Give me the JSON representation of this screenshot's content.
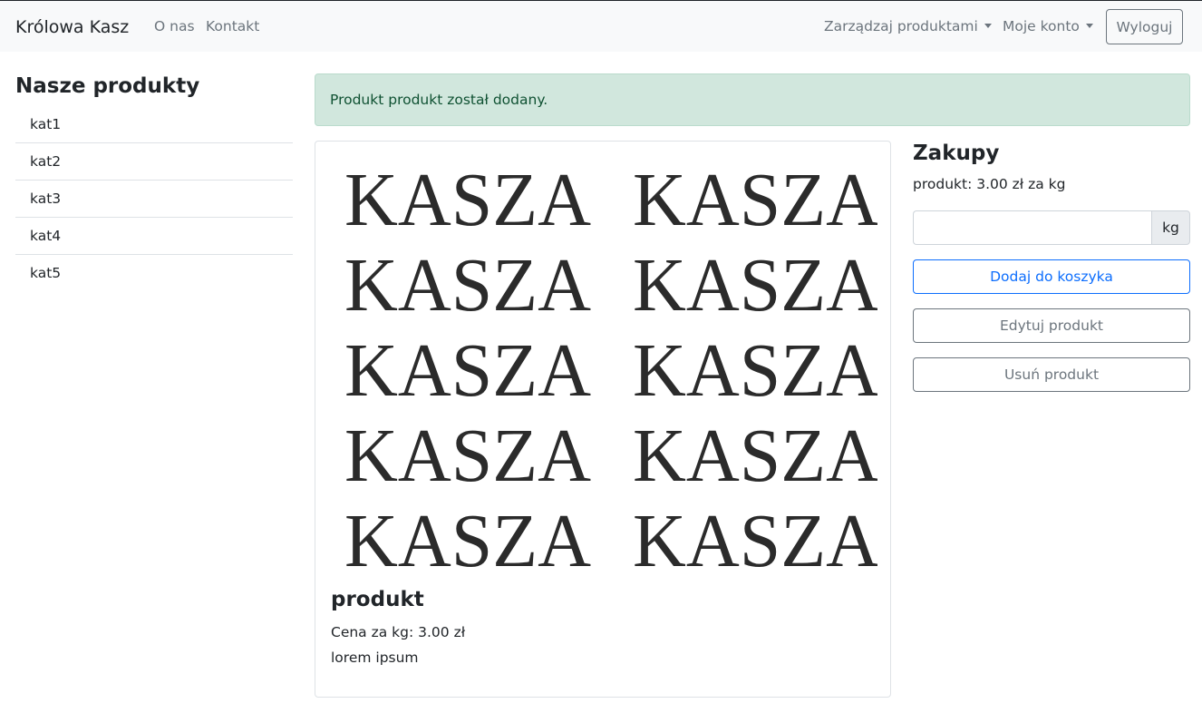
{
  "navbar": {
    "brand": "Królowa Kasz",
    "links": [
      "O nas",
      "Kontakt"
    ],
    "manage_products": "Zarządzaj produktami",
    "my_account": "Moje konto",
    "logout": "Wyloguj"
  },
  "sidebar": {
    "title": "Nasze produkty",
    "categories": [
      "kat1",
      "kat2",
      "kat3",
      "kat4",
      "kat5"
    ]
  },
  "alert": {
    "message": "Produkt produkt został dodany."
  },
  "product": {
    "image_text": "KASZA",
    "name": "produkt",
    "price_line": "Cena za kg: 3.00 zł",
    "description": "lorem ipsum"
  },
  "purchase": {
    "title": "Zakupy",
    "info": "produkt: 3.00 zł za kg",
    "quantity_value": "",
    "unit": "kg",
    "add_to_cart": "Dodaj do koszyka",
    "edit_product": "Edytuj produkt",
    "delete_product": "Usuń produkt"
  },
  "colors": {
    "primary": "#0d6efd",
    "secondary": "#6c757d",
    "alert_bg": "#d1e7dd",
    "alert_text": "#0f5132"
  }
}
